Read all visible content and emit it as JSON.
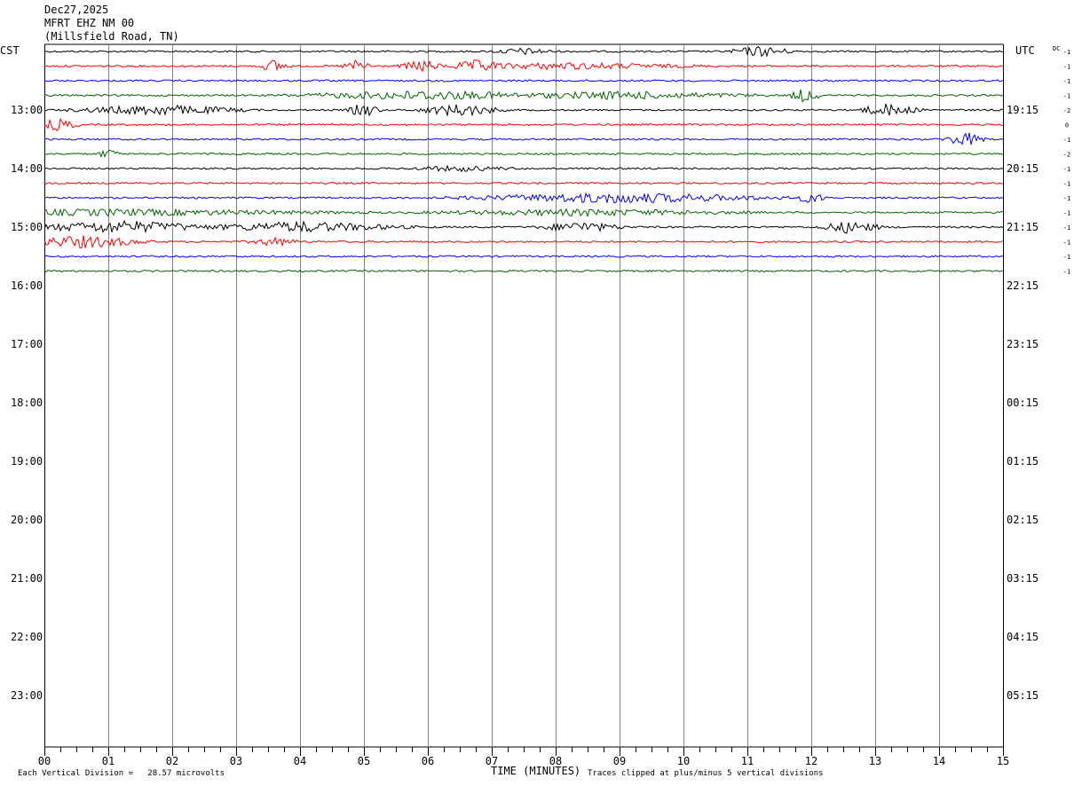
{
  "header": {
    "date": "Dec27,2025",
    "station": "MFRT EHZ NM 00",
    "location": "(Millsfield Road, TN)"
  },
  "corner_left": "CST",
  "corner_right": "UTC",
  "dc_label": "DC",
  "footer": {
    "scale_note": "Each Vertical Division =   28.57 microvolts",
    "clip_note": "Traces clipped at plus/minus 5 vertical divisions",
    "xlabel": "TIME (MINUTES)"
  },
  "colors": {
    "trace_cycle": [
      "#000000",
      "#ff0000",
      "#0000ff",
      "#006400"
    ],
    "gridline": "#808080"
  },
  "chart_data": {
    "type": "line",
    "title": "",
    "xlabel": "TIME (MINUTES)",
    "xlim": [
      0,
      15
    ],
    "x_ticks": [
      "00",
      "01",
      "02",
      "03",
      "04",
      "05",
      "06",
      "07",
      "08",
      "09",
      "10",
      "11",
      "12",
      "13",
      "14",
      "15"
    ],
    "left_hour_labels": [
      "13:00",
      "14:00",
      "15:00",
      "16:00",
      "17:00",
      "18:00",
      "19:00",
      "20:00",
      "21:00",
      "22:00",
      "23:00"
    ],
    "right_hour_labels": [
      "19:15",
      "20:15",
      "21:15",
      "22:15",
      "23:15",
      "00:15",
      "01:15",
      "02:15",
      "03:15",
      "04:15",
      "05:15"
    ],
    "rows_per_hour": 4,
    "first_row_time_cst": "12:15",
    "rows": [
      {
        "dc": "-1",
        "color": "black",
        "bursts": [
          [
            7.5,
            0.6,
            1.5
          ],
          [
            11.2,
            0.6,
            2.5
          ]
        ]
      },
      {
        "dc": "-1",
        "color": "red",
        "bursts": [
          [
            3.6,
            0.3,
            3
          ],
          [
            4.9,
            0.3,
            3
          ],
          [
            5.9,
            0.4,
            3
          ],
          [
            6.8,
            0.6,
            3
          ],
          [
            8.2,
            2.5,
            1.5
          ]
        ]
      },
      {
        "dc": "-1",
        "color": "blue",
        "bursts": []
      },
      {
        "dc": "-1",
        "color": "green",
        "bursts": [
          [
            6.0,
            2.5,
            2.2
          ],
          [
            9.0,
            2.5,
            1.8
          ],
          [
            11.9,
            0.3,
            3.5
          ]
        ]
      },
      {
        "dc": "-2",
        "color": "black",
        "bursts": [
          [
            1.8,
            1.6,
            2.5
          ],
          [
            5.0,
            0.3,
            3.5
          ],
          [
            6.5,
            0.8,
            3
          ],
          [
            13.2,
            0.6,
            3
          ]
        ]
      },
      {
        "dc": "0",
        "color": "red",
        "bursts": [
          [
            0.2,
            0.4,
            3
          ]
        ]
      },
      {
        "dc": "-1",
        "color": "blue",
        "bursts": [
          [
            14.4,
            0.4,
            3.5
          ]
        ]
      },
      {
        "dc": "-2",
        "color": "green",
        "bursts": [
          [
            1.0,
            0.2,
            2.5
          ]
        ]
      },
      {
        "dc": "-1",
        "color": "black",
        "bursts": [
          [
            6.5,
            1.0,
            1.2
          ]
        ]
      },
      {
        "dc": "-1",
        "color": "red",
        "bursts": []
      },
      {
        "dc": "-1",
        "color": "blue",
        "bursts": [
          [
            9.0,
            3.0,
            2.5
          ],
          [
            12.0,
            0.3,
            2.5
          ]
        ]
      },
      {
        "dc": "-1",
        "color": "green",
        "bursts": [
          [
            1.0,
            4.5,
            1.5
          ],
          [
            8.5,
            3.0,
            1.5
          ]
        ]
      },
      {
        "dc": "-1",
        "color": "black",
        "bursts": [
          [
            1.2,
            1.8,
            3
          ],
          [
            4.0,
            2.0,
            2.5
          ],
          [
            8.4,
            0.8,
            2.5
          ],
          [
            12.6,
            0.6,
            3
          ]
        ]
      },
      {
        "dc": "-1",
        "color": "red",
        "bursts": [
          [
            0.6,
            1.2,
            3
          ],
          [
            3.6,
            0.5,
            2
          ]
        ]
      },
      {
        "dc": "-1",
        "color": "blue",
        "bursts": []
      },
      {
        "dc": "-1",
        "color": "green",
        "bursts": []
      }
    ]
  }
}
